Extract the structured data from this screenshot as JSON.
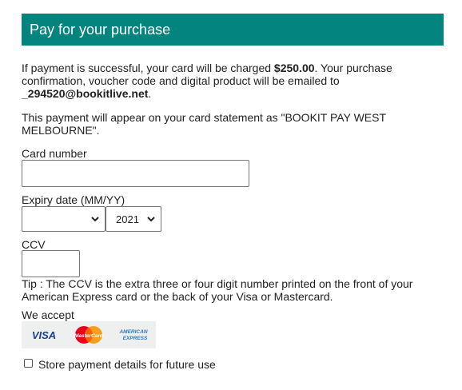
{
  "header": {
    "title": "Pay for your purchase"
  },
  "info": {
    "line1_prefix": "If payment is successful, your card will be charged ",
    "amount": "$250.00",
    "line1_suffix": ". Your purchase confirmation, voucher code and digital product will be emailed to ",
    "email": "_294520@bookitlive.net",
    "line1_end": "."
  },
  "statement": {
    "text": "This payment will appear on your card statement as \"BOOKIT PAY WEST MELBOURNE\"."
  },
  "form": {
    "card_number_label": "Card number",
    "card_number_value": "",
    "expiry_label": "Expiry date (MM/YY)",
    "expiry_month_value": "",
    "expiry_year_value": "2021",
    "ccv_label": "CCV",
    "ccv_value": "",
    "tip": "Tip : The CCV is the extra three or four digit number printed on the front of your American Express card or the back of your Visa or Mastercard.",
    "we_accept_label": "We accept",
    "store_checkbox_label": "Store payment details for future use",
    "store_checked": false
  },
  "cards": {
    "visa": "VISA",
    "mastercard": "MasterCard",
    "amex_line1": "AMERICAN",
    "amex_line2": "EXPRESS"
  },
  "colors": {
    "header_bg": "#03847f",
    "visa": "#1a3e8c",
    "mc_red": "#eb001b",
    "mc_orange": "#f79e1b",
    "amex": "#2e77bc"
  }
}
